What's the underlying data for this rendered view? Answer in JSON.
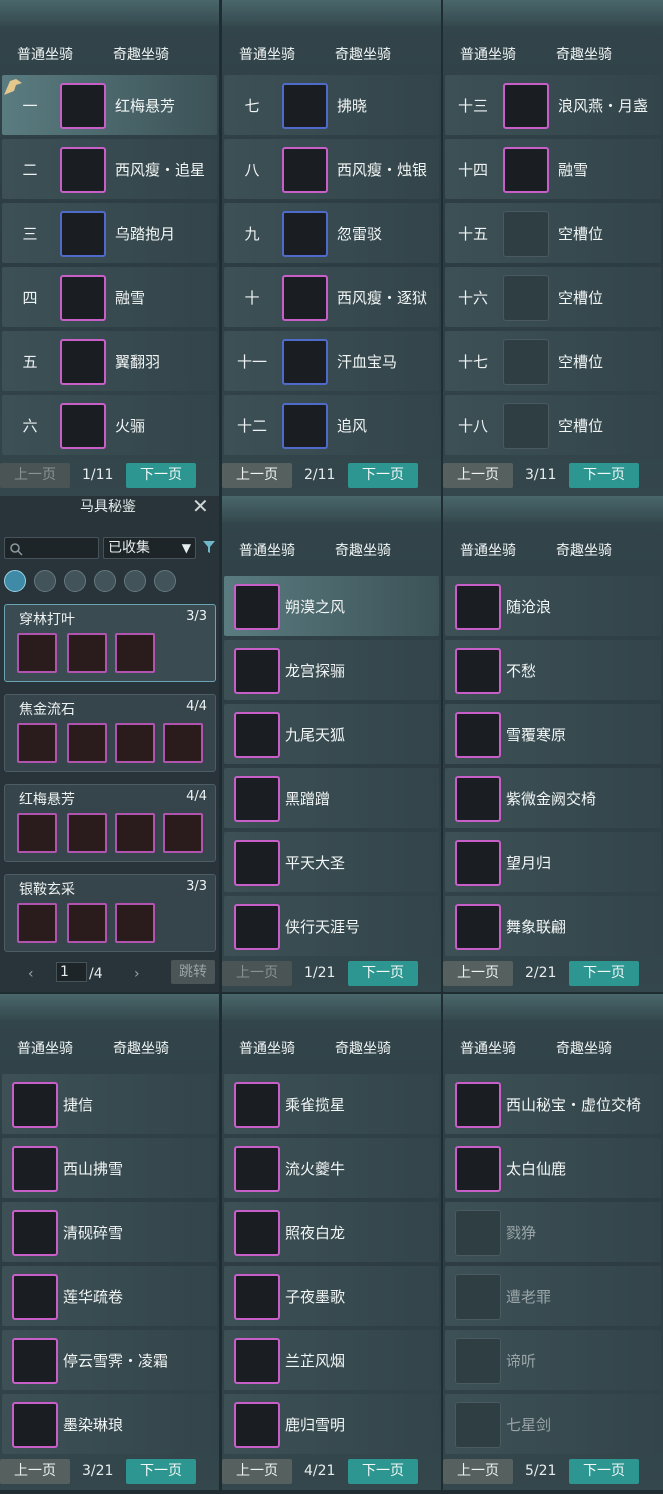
{
  "tabs": {
    "normal": "普通坐骑",
    "fun": "奇趣坐骑"
  },
  "pager": {
    "prev": "上一页",
    "next": "下一页"
  },
  "panels": [
    {
      "page": "1/11",
      "rows": [
        {
          "idx": "一",
          "name": "红梅悬芳",
          "icon": "white-horse"
        },
        {
          "idx": "二",
          "name": "西风瘦・追星",
          "icon": "white-horse"
        },
        {
          "idx": "三",
          "name": "乌踏抱月",
          "icon": "white-horse"
        },
        {
          "idx": "四",
          "name": "融雪",
          "icon": "white-horse"
        },
        {
          "idx": "五",
          "name": "翼翻羽",
          "icon": "black-horse"
        },
        {
          "idx": "六",
          "name": "火骊",
          "icon": "black-horse"
        }
      ]
    },
    {
      "page": "2/11",
      "rows": [
        {
          "idx": "七",
          "name": "拂晓",
          "icon": "red-horse"
        },
        {
          "idx": "八",
          "name": "西风瘦・烛银",
          "icon": "red-horse"
        },
        {
          "idx": "九",
          "name": "忽雷驳",
          "icon": "black-horse"
        },
        {
          "idx": "十",
          "name": "西风瘦・逐狱",
          "icon": "black-horse"
        },
        {
          "idx": "十一",
          "name": "汗血宝马",
          "icon": "brown-horse"
        },
        {
          "idx": "十二",
          "name": "追风",
          "icon": "white-horse"
        }
      ]
    },
    {
      "page": "3/11",
      "rows": [
        {
          "idx": "十三",
          "name": "浪风燕・月盏",
          "icon": "white-horse"
        },
        {
          "idx": "十四",
          "name": "融雪",
          "icon": "white-horse"
        },
        {
          "idx": "十五",
          "name": "空槽位",
          "icon": "empty-slot"
        },
        {
          "idx": "十六",
          "name": "空槽位",
          "icon": "empty-slot"
        },
        {
          "idx": "十七",
          "name": "空槽位",
          "icon": "empty-slot"
        },
        {
          "idx": "十八",
          "name": "空槽位",
          "icon": "empty-slot"
        }
      ]
    },
    {
      "page": "1/21",
      "rows": [
        {
          "name": "朔漠之风",
          "icon": "chariot"
        },
        {
          "name": "龙宫探骊",
          "icon": "crystal-beast"
        },
        {
          "name": "九尾天狐",
          "icon": "white-fox"
        },
        {
          "name": "黑蹭蹭",
          "icon": "round-beast"
        },
        {
          "name": "平天大圣",
          "icon": "grey-beast"
        },
        {
          "name": "侠行天涯号",
          "icon": "vehicle"
        }
      ]
    },
    {
      "page": "2/21",
      "rows": [
        {
          "name": "随沧浪",
          "icon": "raft"
        },
        {
          "name": "不愁",
          "icon": "bird"
        },
        {
          "name": "雪覆寒原",
          "icon": "white-deer"
        },
        {
          "name": "紫微金阙交椅",
          "icon": "chair"
        },
        {
          "name": "望月归",
          "icon": "moon-deer"
        },
        {
          "name": "舞象联翩",
          "icon": "elephant"
        }
      ]
    },
    {
      "page": "3/21",
      "rows": [
        {
          "name": "捷信",
          "icon": "elephant"
        },
        {
          "name": "西山拂雪",
          "icon": "white-deer"
        },
        {
          "name": "清砚碎雪",
          "icon": "white-horse"
        },
        {
          "name": "莲华疏卷",
          "icon": "white-horse"
        },
        {
          "name": "停云雪霁・凌霜",
          "icon": "sled"
        },
        {
          "name": "墨染琳琅",
          "icon": "ink-beast"
        }
      ]
    },
    {
      "page": "4/21",
      "rows": [
        {
          "name": "乘雀揽星",
          "icon": "lotus"
        },
        {
          "name": "流火夔牛",
          "icon": "red-ox"
        },
        {
          "name": "照夜白龙",
          "icon": "white-dragon-horse"
        },
        {
          "name": "子夜墨歌",
          "icon": "dark-beast"
        },
        {
          "name": "兰芷风烟",
          "icon": "teal-beast"
        },
        {
          "name": "鹿归雪明",
          "icon": "red-deer"
        }
      ]
    },
    {
      "page": "5/21",
      "rows": [
        {
          "name": "西山秘宝・虚位交椅",
          "icon": "lady-portrait"
        },
        {
          "name": "太白仙鹿",
          "icon": "antler"
        },
        {
          "name": "戮狰",
          "icon": "locked-beast",
          "locked": true
        },
        {
          "name": "遭老罪",
          "icon": "locked-man",
          "locked": true
        },
        {
          "name": "谛听",
          "icon": "locked-dog",
          "locked": true
        },
        {
          "name": "七星剑",
          "icon": "locked-sword",
          "locked": true
        }
      ]
    }
  ],
  "set_panel": {
    "title": "马具秘鉴",
    "filter_value": "已收集",
    "groups": [
      {
        "name": "穿林打叶",
        "count": "3/3",
        "items": 3
      },
      {
        "name": "焦金流石",
        "count": "4/4",
        "items": 4
      },
      {
        "name": "红梅悬芳",
        "count": "4/4",
        "items": 4
      },
      {
        "name": "银鞍玄采",
        "count": "3/3",
        "items": 3
      }
    ],
    "page_input": "1",
    "page_total": "/4",
    "jump": "跳转"
  },
  "colors": {
    "accent": "#2d9690",
    "rarity_purple": "#c85ec8",
    "rarity_blue": "#4f6ac8"
  }
}
